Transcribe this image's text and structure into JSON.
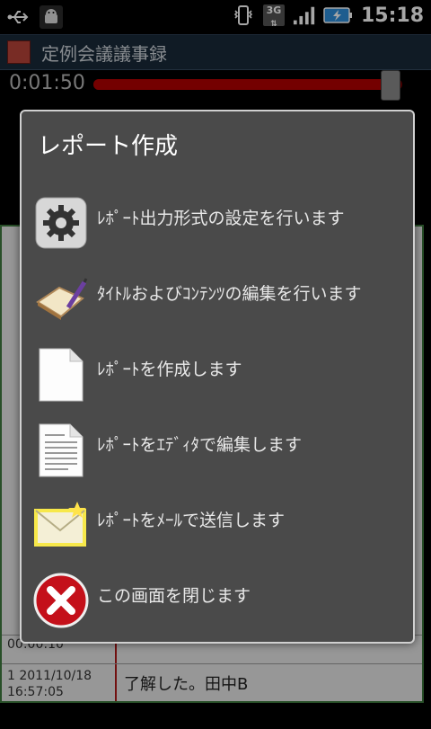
{
  "status": {
    "time": "15:18",
    "signal": "3G"
  },
  "app": {
    "title": "定例会議議事録"
  },
  "player": {
    "elapsed": "0:01:50",
    "progress": 0.95
  },
  "background": {
    "rows": [
      {
        "meta": "1 2011/10/18 16:57:05",
        "msg": "了解した。田中B"
      },
      {
        "meta": "00:00:10",
        "msg": ""
      }
    ]
  },
  "dialog": {
    "title": "レポート作成",
    "items": [
      {
        "label": "ﾚﾎﾟｰﾄ出力形式の設定を行います"
      },
      {
        "label": "ﾀｲﾄﾙおよびｺﾝﾃﾝﾂの編集を行います"
      },
      {
        "label": "ﾚﾎﾟｰﾄを作成します"
      },
      {
        "label": "ﾚﾎﾟｰﾄをｴﾃﾞｨﾀで編集します"
      },
      {
        "label": "ﾚﾎﾟｰﾄをﾒｰﾙで送信します"
      },
      {
        "label": "この画面を閉じます"
      }
    ]
  }
}
